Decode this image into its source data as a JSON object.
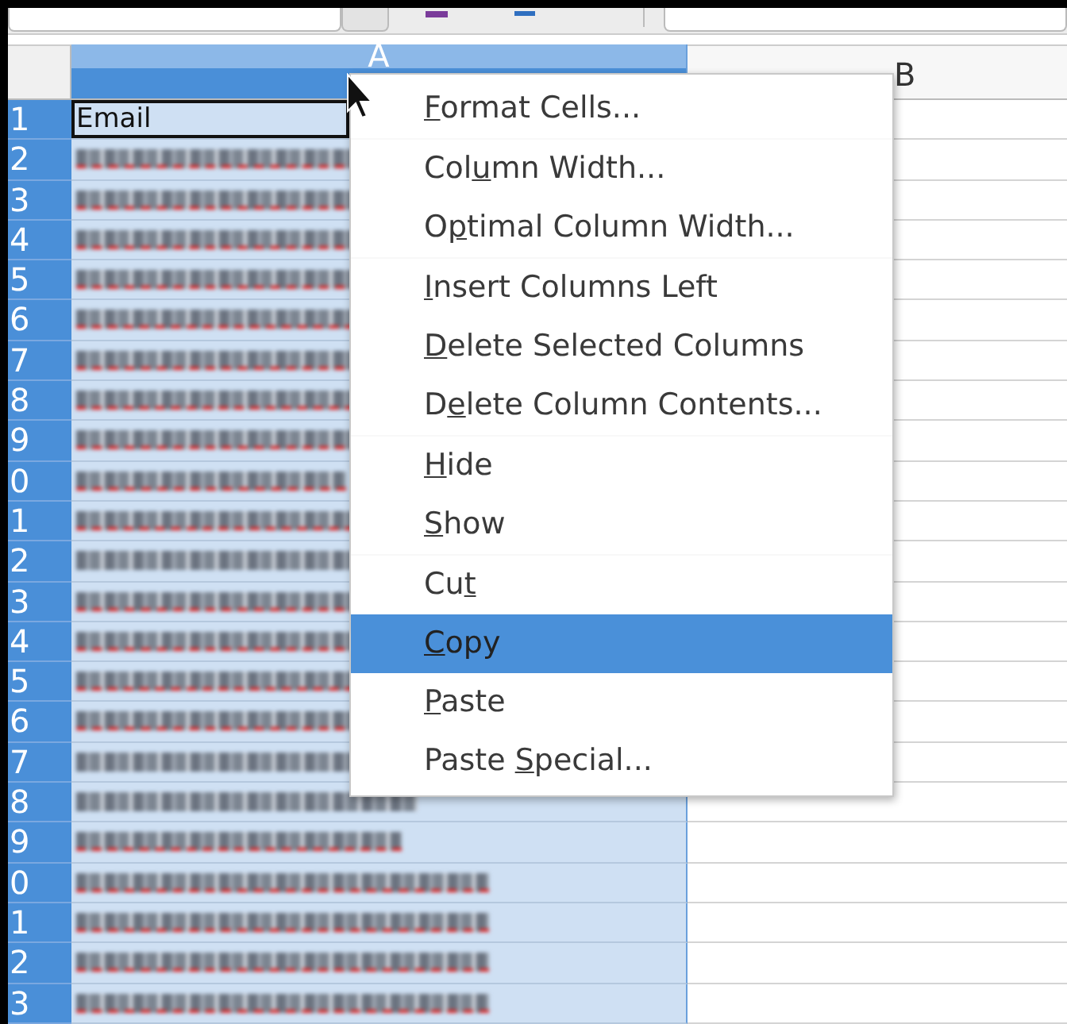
{
  "columns": [
    {
      "header": "A",
      "selected": true
    },
    {
      "header": "B",
      "selected": false
    }
  ],
  "rows": [
    {
      "number": "1",
      "kind": "text",
      "value": "Email",
      "active": true,
      "misspelled": false
    },
    {
      "number": "2",
      "kind": "blurred",
      "active": false,
      "misspelled": true
    },
    {
      "number": "3",
      "kind": "blurred",
      "active": false,
      "misspelled": true
    },
    {
      "number": "4",
      "kind": "blurred",
      "active": false,
      "misspelled": true
    },
    {
      "number": "5",
      "kind": "blurred",
      "active": false,
      "misspelled": true
    },
    {
      "number": "6",
      "kind": "blurred",
      "active": false,
      "misspelled": true
    },
    {
      "number": "7",
      "kind": "blurred",
      "active": false,
      "misspelled": true
    },
    {
      "number": "8",
      "kind": "blurred",
      "active": false,
      "misspelled": true
    },
    {
      "number": "9",
      "kind": "blurred",
      "active": false,
      "misspelled": true
    },
    {
      "number": "0",
      "kind": "blurred",
      "active": false,
      "misspelled": true
    },
    {
      "number": "1",
      "kind": "blurred",
      "active": false,
      "misspelled": true
    },
    {
      "number": "2",
      "kind": "blurred",
      "active": false,
      "misspelled": false
    },
    {
      "number": "3",
      "kind": "blurred",
      "active": false,
      "misspelled": true
    },
    {
      "number": "4",
      "kind": "blurred",
      "active": false,
      "misspelled": true
    },
    {
      "number": "5",
      "kind": "blurred",
      "active": false,
      "misspelled": true
    },
    {
      "number": "6",
      "kind": "blurred",
      "active": false,
      "misspelled": true
    },
    {
      "number": "7",
      "kind": "blurred",
      "active": false,
      "misspelled": false
    },
    {
      "number": "8",
      "kind": "blurred",
      "active": false,
      "misspelled": false
    },
    {
      "number": "9",
      "kind": "blurred",
      "active": false,
      "misspelled": true
    },
    {
      "number": "0",
      "kind": "blurred",
      "active": false,
      "misspelled": true
    },
    {
      "number": "1",
      "kind": "blurred",
      "active": false,
      "misspelled": true
    },
    {
      "number": "2",
      "kind": "blurred",
      "active": false,
      "misspelled": true
    },
    {
      "number": "3",
      "kind": "blurred",
      "active": false,
      "misspelled": true
    }
  ],
  "context_menu": {
    "groups": [
      [
        {
          "mnemonic": "F",
          "after": "ormat Cells...",
          "selected": false
        }
      ],
      [
        {
          "before": "Col",
          "mnemonic": "u",
          "after": "mn Width...",
          "selected": false
        },
        {
          "before": "O",
          "mnemonic": "p",
          "after": "timal Column Width...",
          "selected": false
        }
      ],
      [
        {
          "mnemonic": "I",
          "after": "nsert Columns Left",
          "selected": false
        },
        {
          "mnemonic": "D",
          "after": "elete Selected Columns",
          "selected": false
        },
        {
          "before": "D",
          "mnemonic": "e",
          "after": "lete Column Contents...",
          "selected": false
        }
      ],
      [
        {
          "mnemonic": "H",
          "after": "ide",
          "selected": false
        },
        {
          "mnemonic": "S",
          "after": "how",
          "selected": false
        }
      ],
      [
        {
          "before": "Cu",
          "mnemonic": "t",
          "selected": false
        },
        {
          "mnemonic": "C",
          "after": "opy",
          "selected": true
        },
        {
          "mnemonic": "P",
          "after": "aste",
          "selected": false
        },
        {
          "before": "Paste ",
          "mnemonic": "S",
          "after": "pecial...",
          "selected": false
        }
      ]
    ]
  }
}
